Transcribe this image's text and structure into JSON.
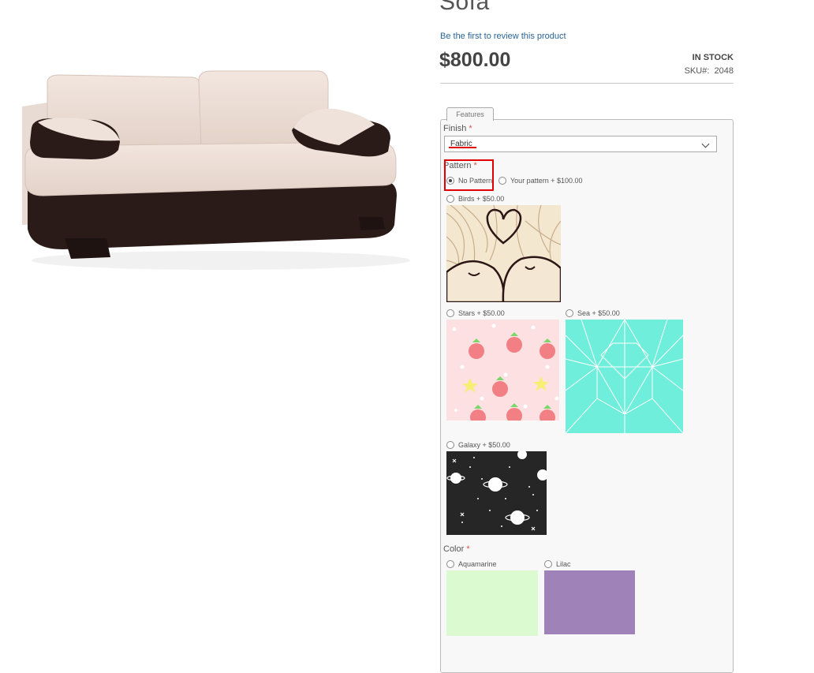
{
  "product": {
    "title": "Sofa",
    "review_link": "Be the first to review this product",
    "price": "$800.00",
    "stock": "IN STOCK",
    "sku_label": "SKU#:",
    "sku_value": "2048"
  },
  "features": {
    "tab_label": "Features",
    "finish": {
      "label": "Finish",
      "required": "*",
      "selected": "Fabric"
    },
    "pattern": {
      "label": "Pattern",
      "required": "*",
      "options": [
        {
          "label": "No Pattern",
          "checked": true
        },
        {
          "label": "Your pattern + $100.00",
          "checked": false
        },
        {
          "label": "Birds + $50.00",
          "checked": false
        },
        {
          "label": "Stars + $50.00",
          "checked": false
        },
        {
          "label": "Sea + $50.00",
          "checked": false
        },
        {
          "label": "Galaxy + $50.00",
          "checked": false
        }
      ]
    },
    "color": {
      "label": "Color",
      "required": "*",
      "options": [
        {
          "label": "Aquamarine",
          "swatch": "#dcfad0"
        },
        {
          "label": "Lilac",
          "swatch": "#9e82b8"
        }
      ]
    }
  },
  "colors": {
    "accent_link": "#2a6496",
    "required": "#d9534f",
    "highlight": "#e00000",
    "stars_bg": "#fde0e1",
    "sea_bg": "#6eeedb",
    "galaxy_bg": "#262626",
    "birds_bg": "#f3e7cf"
  }
}
